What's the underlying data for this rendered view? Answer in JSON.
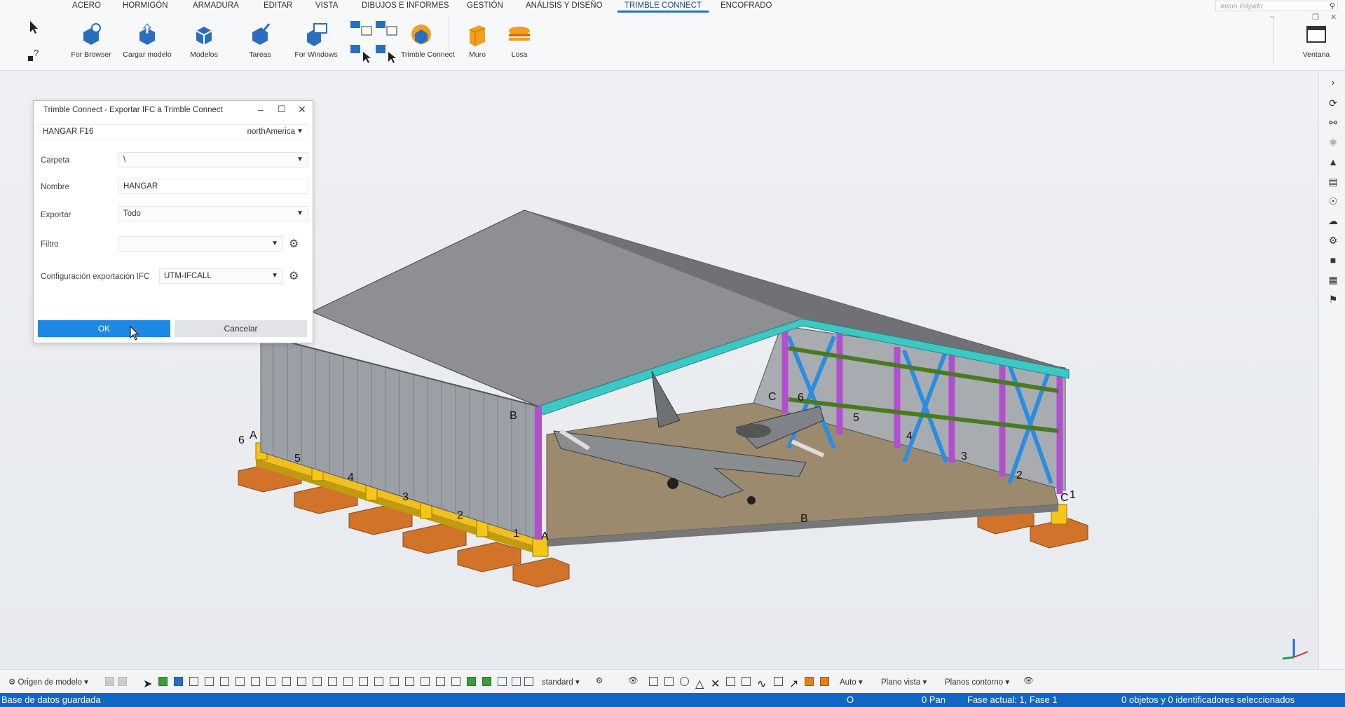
{
  "menu": {
    "tabs": [
      "ACERO",
      "HORMIGÓN",
      "ARMADURA",
      "EDITAR",
      "VISTA",
      "DIBUJOS E INFORMES",
      "GESTIÓN",
      "ANÁLISIS Y DISEÑO",
      "TRIMBLE CONNECT",
      "ENCOFRADO"
    ],
    "active_tab": "TRIMBLE CONNECT",
    "quick_search_placeholder": "Inicio Rápido"
  },
  "ribbon": {
    "buttons": [
      "For Browser",
      "Cargar modelo",
      "Modelos",
      "Tareas",
      "For Windows",
      "Trimble Connect",
      "Muro",
      "Losa"
    ],
    "right_button": "Ventana"
  },
  "dialog": {
    "title": "Trimble Connect - Exportar IFC a Trimble Connect",
    "project": "HANGAR F16",
    "region": "northAmerica",
    "fields": [
      {
        "label": "Carpeta",
        "value": "\\"
      },
      {
        "label": "Nombre",
        "value": "HANGAR"
      },
      {
        "label": "Exportar",
        "value": "Todo"
      },
      {
        "label": "Filtro",
        "value": ""
      },
      {
        "label": "Configuración exportación IFC",
        "value": "UTM-IFCALL"
      }
    ],
    "ok_label": "OK",
    "cancel_label": "Cancelar"
  },
  "model": {
    "grid_labels": [
      "A",
      "B",
      "C",
      "1",
      "2",
      "3",
      "4",
      "5",
      "6"
    ]
  },
  "bottom_toolbar": {
    "origin": "Origen de modelo",
    "standard": "standard",
    "auto": "Auto",
    "plane_view": "Plano vista",
    "contour_planes": "Planos contorno"
  },
  "status": {
    "saved": "Base de datos guardada",
    "o": "O",
    "pan": "0 Pan",
    "phase": "Fase actual: 1, Fase 1",
    "selection": "0 objetos y 0 identificadores seleccionados"
  },
  "colors": {
    "accent": "#1e88e5",
    "status_bar": "#1266c4",
    "menu_blue": "#0e3d7a"
  }
}
